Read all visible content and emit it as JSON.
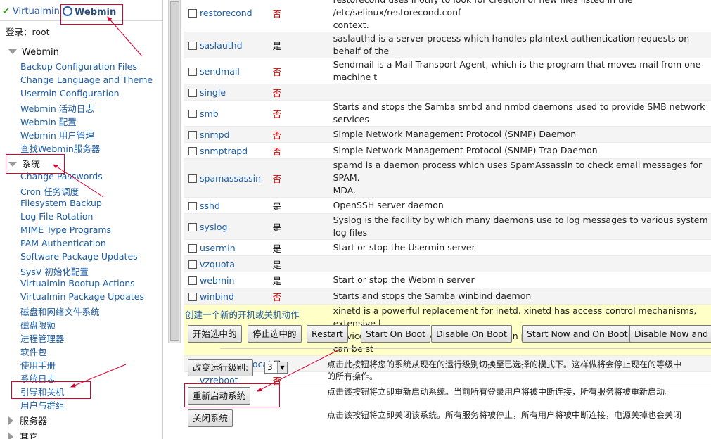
{
  "left": {
    "tabs": {
      "virtualmin": "Virtualmin",
      "webmin": "Webmin"
    },
    "login": "登录：root",
    "categories": {
      "webmin": "Webmin",
      "system": "系统",
      "servers": "服务器",
      "others": "其它"
    },
    "webmin_items": [
      "Backup Configuration Files",
      "Change Language and Theme",
      "Usermin Configuration",
      "Webmin 活动日志",
      "Webmin 配置",
      "Webmin 用户管理",
      "查找Webmin服务器"
    ],
    "system_items": [
      "Change Passwords",
      "Cron 任务调度",
      "Filesystem Backup",
      "Log File Rotation",
      "MIME Type Programs",
      "PAM Authentication",
      "Software Package Updates",
      "SysV 初始化配置",
      "Virtualmin Bootup Actions",
      "Virtualmin Package Updates",
      "磁盘和网络文件系统",
      "磁盘限额",
      "进程管理器",
      "软件包",
      "使用手册",
      "系统日志",
      "引导和关机",
      "用户与群组"
    ]
  },
  "services": [
    {
      "name": "restorecond",
      "boot": "否",
      "yes": false,
      "desc": "restorecond uses inotify to look for creation of new files listed in the /etc/selinux/restorecond.conf",
      "desc2": "context.",
      "h": 36
    },
    {
      "name": "saslauthd",
      "boot": "是",
      "yes": true,
      "desc": "saslauthd is a server process which handles plaintext authentication requests on behalf of the"
    },
    {
      "name": "sendmail",
      "boot": "否",
      "yes": false,
      "desc": "Sendmail is a Mail Transport Agent, which is the program that moves mail from one machine t"
    },
    {
      "name": "single",
      "boot": "否",
      "yes": false,
      "desc": ""
    },
    {
      "name": "smb",
      "boot": "否",
      "yes": false,
      "desc": "Starts and stops the Samba smbd and nmbd daemons used to provide SMB network services"
    },
    {
      "name": "snmpd",
      "boot": "否",
      "yes": false,
      "desc": "Simple Network Management Protocol (SNMP) Daemon"
    },
    {
      "name": "snmptrapd",
      "boot": "否",
      "yes": false,
      "desc": "Simple Network Management Protocol (SNMP) Trap Daemon"
    },
    {
      "name": "spamassassin",
      "boot": "否",
      "yes": false,
      "desc": "spamd is a daemon process which uses SpamAssassin to check email messages for SPAM.",
      "desc2": "MDA.",
      "h": 42
    },
    {
      "name": "sshd",
      "boot": "是",
      "yes": true,
      "desc": "OpenSSH server daemon"
    },
    {
      "name": "syslog",
      "boot": "是",
      "yes": true,
      "desc": "Syslog is the facility by which many daemons use to log messages to various system log files"
    },
    {
      "name": "usermin",
      "boot": "是",
      "yes": true,
      "desc": "Start or stop the Usermin server"
    },
    {
      "name": "vzquota",
      "boot": "是",
      "yes": true,
      "desc": ""
    },
    {
      "name": "webmin",
      "boot": "是",
      "yes": true,
      "desc": "Start or stop the Webmin server"
    },
    {
      "name": "winbind",
      "boot": "否",
      "yes": false,
      "desc": "Starts and stops the Samba winbind daemon"
    },
    {
      "name": "xinetd",
      "boot": "是",
      "yes": true,
      "desc": "xinetd is a powerful replacement for inetd. xinetd has access control mechanisms, extensive l",
      "desc2": "services available based on time, and can place limits on the number of servers that can be st",
      "h": 42,
      "highlight": true
    },
    {
      "name": "/etc/rc.d/rc.local",
      "boot": "是",
      "yes": true,
      "desc": ""
    },
    {
      "name": "vzreboot",
      "boot": "否",
      "yes": false,
      "desc": "",
      "nocheck": true
    }
  ],
  "create_link": "创建一个新的开机或关机动作",
  "actions": {
    "start_selected": "开始选中的",
    "stop_selected": "停止选中的",
    "restart": "Restart",
    "start_on_boot": "Start On Boot",
    "disable_on_boot": "Disable On Boot",
    "start_now_and_on_boot": "Start Now and On Boot",
    "disable_now_and_on_boot": "Disable Now and O"
  },
  "runlevel": {
    "button": "改变运行级别:",
    "value": "3",
    "desc_line1": "点击此按钮将您的系统从现在的运行级别切换至已选择的模式下。这样做将会停止现在的等级中",
    "desc_line2": "的所有操作。"
  },
  "reboot": {
    "button": "重新启动系统",
    "desc": "点击该按钮将立即重新启动系统。当前所有登录用户将被中断连接，所有服务将被重新启动。"
  },
  "shutdown": {
    "button": "关闭系统",
    "desc": "点击该按钮将立即关闭该系统。所有服务将被停止，所有用户将被中断连接，电源关掉也会关闭"
  },
  "colors": {
    "link": "#1c5da6",
    "no": "#dd0000",
    "highlight": "#ffffc8",
    "annotation": "#d8002c"
  }
}
